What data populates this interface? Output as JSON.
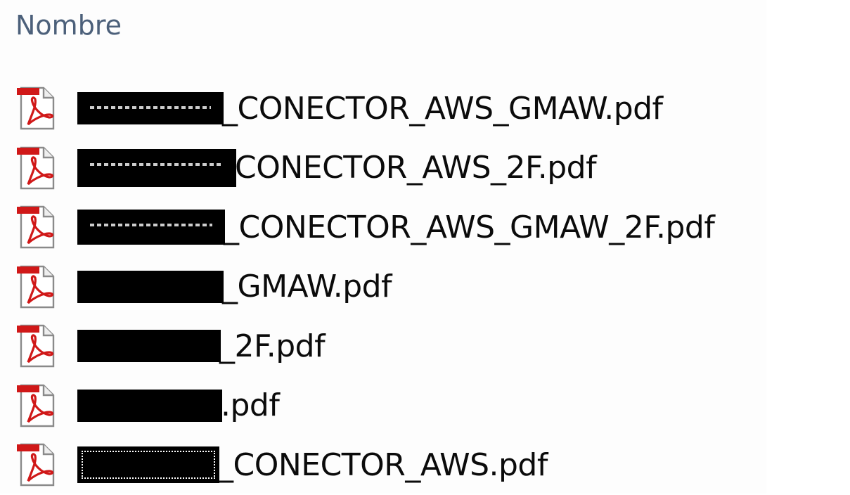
{
  "header": {
    "column_name": "Nombre"
  },
  "files": [
    {
      "name_suffix": "_CONECTOR_AWS_GMAW.pdf",
      "icon": "pdf-icon",
      "redacted": true
    },
    {
      "name_suffix": "CONECTOR_AWS_2F.pdf",
      "icon": "pdf-icon",
      "redacted": true
    },
    {
      "name_suffix": "_CONECTOR_AWS_GMAW_2F.pdf",
      "icon": "pdf-icon",
      "redacted": true
    },
    {
      "name_suffix": "_GMAW.pdf",
      "icon": "pdf-icon",
      "redacted": true
    },
    {
      "name_suffix": "_2F.pdf",
      "icon": "pdf-icon",
      "redacted": true
    },
    {
      "name_suffix": ".pdf",
      "icon": "pdf-icon",
      "redacted": true
    },
    {
      "name_suffix": "_CONECTOR_AWS.pdf",
      "icon": "pdf-icon",
      "redacted": true
    }
  ],
  "colors": {
    "header_text": "#4c607a",
    "file_text": "#0b0b0b",
    "pdf_red": "#d01818",
    "redaction": "#000000"
  }
}
